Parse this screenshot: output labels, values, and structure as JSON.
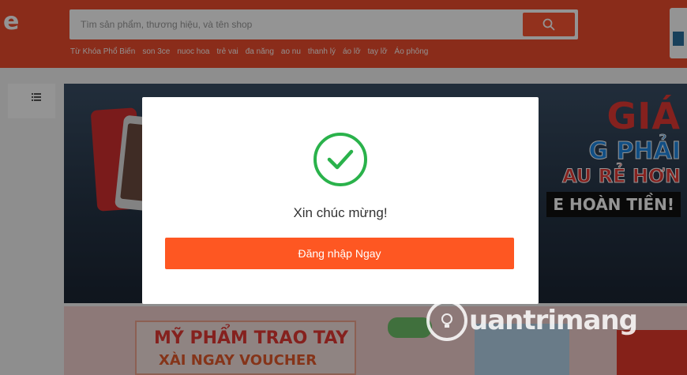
{
  "header": {
    "logo_text": "e",
    "search": {
      "placeholder": "Tìm sản phẩm, thương hiệu, và tên shop",
      "value": ""
    },
    "search_icon": "search-icon",
    "keywords_label": "Từ Khóa Phổ Biến",
    "keywords": [
      "son 3ce",
      "nuoc hoa",
      "trẻ vai",
      "đa năng",
      "ao nu",
      "thanh lý",
      "áo lỡ",
      "tay lỡ",
      "Áo phông"
    ],
    "brand_color": "#ee4d2d"
  },
  "sidebar": {
    "menu_icon": "list-icon"
  },
  "banner": {
    "line1": "GIÁ",
    "line2": "G PHẢI",
    "line3": "AU RẺ HƠN",
    "line4": "E HOÀN TIỀN!"
  },
  "promo": {
    "line1": "MỸ PHẨM TRAO TAY",
    "line2": "XÀI NGAY VOUCHER"
  },
  "modal": {
    "icon": "check-circle-icon",
    "title": "Xin chúc mừng!",
    "button_label": "Đăng nhập Ngay",
    "button_color": "#fe5722",
    "check_color": "#2ab24b"
  },
  "watermark": {
    "text": "uantrimang"
  }
}
